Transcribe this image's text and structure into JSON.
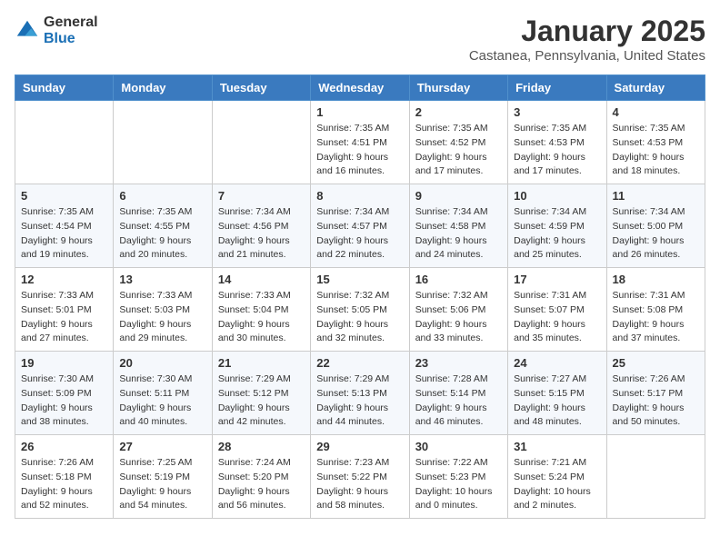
{
  "header": {
    "logo_general": "General",
    "logo_blue": "Blue",
    "month_title": "January 2025",
    "location": "Castanea, Pennsylvania, United States"
  },
  "days_of_week": [
    "Sunday",
    "Monday",
    "Tuesday",
    "Wednesday",
    "Thursday",
    "Friday",
    "Saturday"
  ],
  "weeks": [
    [
      {
        "day": "",
        "info": ""
      },
      {
        "day": "",
        "info": ""
      },
      {
        "day": "",
        "info": ""
      },
      {
        "day": "1",
        "info": "Sunrise: 7:35 AM\nSunset: 4:51 PM\nDaylight: 9 hours\nand 16 minutes."
      },
      {
        "day": "2",
        "info": "Sunrise: 7:35 AM\nSunset: 4:52 PM\nDaylight: 9 hours\nand 17 minutes."
      },
      {
        "day": "3",
        "info": "Sunrise: 7:35 AM\nSunset: 4:53 PM\nDaylight: 9 hours\nand 17 minutes."
      },
      {
        "day": "4",
        "info": "Sunrise: 7:35 AM\nSunset: 4:53 PM\nDaylight: 9 hours\nand 18 minutes."
      }
    ],
    [
      {
        "day": "5",
        "info": "Sunrise: 7:35 AM\nSunset: 4:54 PM\nDaylight: 9 hours\nand 19 minutes."
      },
      {
        "day": "6",
        "info": "Sunrise: 7:35 AM\nSunset: 4:55 PM\nDaylight: 9 hours\nand 20 minutes."
      },
      {
        "day": "7",
        "info": "Sunrise: 7:34 AM\nSunset: 4:56 PM\nDaylight: 9 hours\nand 21 minutes."
      },
      {
        "day": "8",
        "info": "Sunrise: 7:34 AM\nSunset: 4:57 PM\nDaylight: 9 hours\nand 22 minutes."
      },
      {
        "day": "9",
        "info": "Sunrise: 7:34 AM\nSunset: 4:58 PM\nDaylight: 9 hours\nand 24 minutes."
      },
      {
        "day": "10",
        "info": "Sunrise: 7:34 AM\nSunset: 4:59 PM\nDaylight: 9 hours\nand 25 minutes."
      },
      {
        "day": "11",
        "info": "Sunrise: 7:34 AM\nSunset: 5:00 PM\nDaylight: 9 hours\nand 26 minutes."
      }
    ],
    [
      {
        "day": "12",
        "info": "Sunrise: 7:33 AM\nSunset: 5:01 PM\nDaylight: 9 hours\nand 27 minutes."
      },
      {
        "day": "13",
        "info": "Sunrise: 7:33 AM\nSunset: 5:03 PM\nDaylight: 9 hours\nand 29 minutes."
      },
      {
        "day": "14",
        "info": "Sunrise: 7:33 AM\nSunset: 5:04 PM\nDaylight: 9 hours\nand 30 minutes."
      },
      {
        "day": "15",
        "info": "Sunrise: 7:32 AM\nSunset: 5:05 PM\nDaylight: 9 hours\nand 32 minutes."
      },
      {
        "day": "16",
        "info": "Sunrise: 7:32 AM\nSunset: 5:06 PM\nDaylight: 9 hours\nand 33 minutes."
      },
      {
        "day": "17",
        "info": "Sunrise: 7:31 AM\nSunset: 5:07 PM\nDaylight: 9 hours\nand 35 minutes."
      },
      {
        "day": "18",
        "info": "Sunrise: 7:31 AM\nSunset: 5:08 PM\nDaylight: 9 hours\nand 37 minutes."
      }
    ],
    [
      {
        "day": "19",
        "info": "Sunrise: 7:30 AM\nSunset: 5:09 PM\nDaylight: 9 hours\nand 38 minutes."
      },
      {
        "day": "20",
        "info": "Sunrise: 7:30 AM\nSunset: 5:11 PM\nDaylight: 9 hours\nand 40 minutes."
      },
      {
        "day": "21",
        "info": "Sunrise: 7:29 AM\nSunset: 5:12 PM\nDaylight: 9 hours\nand 42 minutes."
      },
      {
        "day": "22",
        "info": "Sunrise: 7:29 AM\nSunset: 5:13 PM\nDaylight: 9 hours\nand 44 minutes."
      },
      {
        "day": "23",
        "info": "Sunrise: 7:28 AM\nSunset: 5:14 PM\nDaylight: 9 hours\nand 46 minutes."
      },
      {
        "day": "24",
        "info": "Sunrise: 7:27 AM\nSunset: 5:15 PM\nDaylight: 9 hours\nand 48 minutes."
      },
      {
        "day": "25",
        "info": "Sunrise: 7:26 AM\nSunset: 5:17 PM\nDaylight: 9 hours\nand 50 minutes."
      }
    ],
    [
      {
        "day": "26",
        "info": "Sunrise: 7:26 AM\nSunset: 5:18 PM\nDaylight: 9 hours\nand 52 minutes."
      },
      {
        "day": "27",
        "info": "Sunrise: 7:25 AM\nSunset: 5:19 PM\nDaylight: 9 hours\nand 54 minutes."
      },
      {
        "day": "28",
        "info": "Sunrise: 7:24 AM\nSunset: 5:20 PM\nDaylight: 9 hours\nand 56 minutes."
      },
      {
        "day": "29",
        "info": "Sunrise: 7:23 AM\nSunset: 5:22 PM\nDaylight: 9 hours\nand 58 minutes."
      },
      {
        "day": "30",
        "info": "Sunrise: 7:22 AM\nSunset: 5:23 PM\nDaylight: 10 hours\nand 0 minutes."
      },
      {
        "day": "31",
        "info": "Sunrise: 7:21 AM\nSunset: 5:24 PM\nDaylight: 10 hours\nand 2 minutes."
      },
      {
        "day": "",
        "info": ""
      }
    ]
  ]
}
